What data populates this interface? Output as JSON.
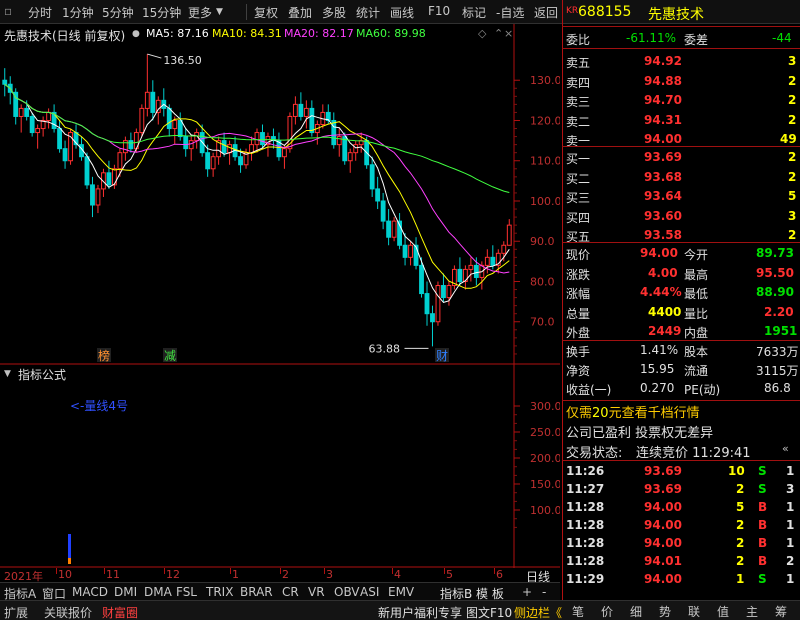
{
  "toolbar": {
    "items": [
      "分时",
      "1分钟",
      "5分钟",
      "15分钟",
      "更多",
      "复权",
      "叠加",
      "多股",
      "统计",
      "画线",
      "F10",
      "标记",
      "-自选",
      "返回"
    ]
  },
  "chart": {
    "title": "先惠技术(日线 前复权)",
    "ma": [
      {
        "label": "MA5: 87.16",
        "color": "#ffffff"
      },
      {
        "label": "MA10: 84.31",
        "color": "#ffff00"
      },
      {
        "label": "MA20: 82.17",
        "color": "#ff40ff"
      },
      {
        "label": "MA60: 89.98",
        "color": "#40ff40"
      }
    ],
    "high_label": "136.50",
    "low_label": "63.88",
    "price_ticks": [
      "130.0",
      "120.0",
      "110.0",
      "100.0",
      "90.0",
      "80.0",
      "70.0"
    ],
    "markers": [
      {
        "text": "榜"
      },
      {
        "text": "减"
      },
      {
        "text": "财"
      }
    ],
    "x_labels": [
      "2021年",
      "10",
      "11",
      "12",
      "1",
      "2",
      "3",
      "4",
      "5",
      "6"
    ],
    "period_label": "日线",
    "candles": [
      [
        130,
        133,
        126,
        129
      ],
      [
        129,
        131,
        124,
        127
      ],
      [
        127,
        128,
        119,
        121
      ],
      [
        121,
        124,
        117,
        123
      ],
      [
        123,
        125,
        120,
        121
      ],
      [
        121,
        122,
        116,
        117
      ],
      [
        117,
        119,
        113,
        118
      ],
      [
        118,
        121,
        116,
        120
      ],
      [
        120,
        123,
        118,
        122
      ],
      [
        122,
        124,
        117,
        118
      ],
      [
        118,
        120,
        112,
        113
      ],
      [
        113,
        115,
        108,
        110
      ],
      [
        110,
        118,
        109,
        117
      ],
      [
        117,
        119,
        113,
        114
      ],
      [
        114,
        116,
        110,
        111
      ],
      [
        111,
        112,
        103,
        104
      ],
      [
        104,
        106,
        96,
        99
      ],
      [
        99,
        104,
        97,
        103
      ],
      [
        103,
        108,
        101,
        107
      ],
      [
        107,
        110,
        103,
        104
      ],
      [
        104,
        109,
        103,
        108
      ],
      [
        108,
        113,
        106,
        112
      ],
      [
        112,
        116,
        110,
        115
      ],
      [
        115,
        117,
        112,
        113
      ],
      [
        113,
        118,
        112,
        117
      ],
      [
        117,
        124,
        116,
        123
      ],
      [
        123,
        136.5,
        121,
        127
      ],
      [
        127,
        130,
        120,
        122
      ],
      [
        122,
        126,
        119,
        125
      ],
      [
        125,
        128,
        121,
        123
      ],
      [
        123,
        124,
        116,
        118
      ],
      [
        118,
        121,
        114,
        120
      ],
      [
        120,
        122,
        115,
        116
      ],
      [
        116,
        118,
        111,
        113
      ],
      [
        113,
        116,
        110,
        115
      ],
      [
        115,
        118,
        113,
        117
      ],
      [
        117,
        119,
        111,
        112
      ],
      [
        112,
        114,
        106,
        108
      ],
      [
        108,
        112,
        106,
        111
      ],
      [
        111,
        116,
        109,
        115
      ],
      [
        115,
        117,
        111,
        112
      ],
      [
        112,
        115,
        109,
        114
      ],
      [
        114,
        116,
        110,
        111
      ],
      [
        111,
        113,
        107,
        109
      ],
      [
        109,
        113,
        108,
        112
      ],
      [
        112,
        116,
        110,
        114
      ],
      [
        114,
        118,
        112,
        117
      ],
      [
        117,
        119,
        113,
        114
      ],
      [
        114,
        117,
        111,
        116
      ],
      [
        116,
        118,
        113,
        115
      ],
      [
        115,
        117,
        110,
        111
      ],
      [
        111,
        114,
        108,
        113
      ],
      [
        113,
        122,
        112,
        121
      ],
      [
        121,
        126,
        119,
        124
      ],
      [
        124,
        127,
        120,
        121
      ],
      [
        121,
        125,
        118,
        123
      ],
      [
        123,
        125,
        116,
        117
      ],
      [
        117,
        120,
        114,
        119
      ],
      [
        119,
        124,
        118,
        122
      ],
      [
        122,
        124,
        119,
        120
      ],
      [
        120,
        122,
        113,
        114
      ],
      [
        114,
        118,
        111,
        116
      ],
      [
        116,
        117,
        109,
        110
      ],
      [
        110,
        113,
        107,
        112
      ],
      [
        112,
        115,
        110,
        114
      ],
      [
        114,
        117,
        112,
        115
      ],
      [
        115,
        116,
        108,
        109
      ],
      [
        109,
        111,
        101,
        103
      ],
      [
        103,
        106,
        98,
        100
      ],
      [
        100,
        102,
        93,
        95
      ],
      [
        95,
        98,
        89,
        91
      ],
      [
        91,
        96,
        90,
        95
      ],
      [
        95,
        97,
        88,
        89
      ],
      [
        89,
        92,
        84,
        86
      ],
      [
        86,
        90,
        84,
        89
      ],
      [
        89,
        91,
        83,
        84
      ],
      [
        84,
        86,
        76,
        77
      ],
      [
        77,
        80,
        69,
        72
      ],
      [
        72,
        74,
        63.88,
        70
      ],
      [
        70,
        80,
        69,
        79
      ],
      [
        79,
        82,
        75,
        76
      ],
      [
        76,
        80,
        74,
        79
      ],
      [
        79,
        84,
        78,
        83
      ],
      [
        83,
        86,
        79,
        80
      ],
      [
        80,
        84,
        78,
        83
      ],
      [
        83,
        86,
        80,
        84
      ],
      [
        84,
        86,
        79,
        81
      ],
      [
        81,
        85,
        78,
        84
      ],
      [
        84,
        88,
        82,
        86
      ],
      [
        86,
        89,
        83,
        84
      ],
      [
        84,
        88,
        82,
        87
      ],
      [
        87,
        90,
        85,
        89
      ],
      [
        89,
        95.5,
        88.9,
        94
      ]
    ]
  },
  "indicator": {
    "title": "指标公式",
    "label": "<-量线4号",
    "ticks": [
      "300.0",
      "250.0",
      "200.0",
      "150.0",
      "100.0"
    ]
  },
  "tabs": [
    "指标A",
    "窗口",
    "MACD",
    "DMI",
    "DMA",
    "FSL",
    "TRIX",
    "BRAR",
    "CR",
    "VR",
    "OBV",
    "ASI",
    "EMV",
    "指标B",
    "模 板",
    "+",
    "-"
  ],
  "status_bar": {
    "items": [
      "扩展",
      "关联报价",
      "财富圈"
    ],
    "promo": "新用户福利专享",
    "right_items": [
      "图文F10",
      "侧边栏《"
    ],
    "panel_tabs": [
      "笔",
      "价",
      "细",
      "势",
      "联",
      "值",
      "主",
      "筹"
    ]
  },
  "quote": {
    "code_prefix": "KR",
    "code": "688155",
    "name": "先惠技术",
    "wei_bi_label": "委比",
    "wei_bi": "-61.11%",
    "wei_cha_label": "委差",
    "wei_cha": "-44",
    "sell": [
      {
        "label": "卖五",
        "price": "94.92",
        "vol": "3"
      },
      {
        "label": "卖四",
        "price": "94.88",
        "vol": "2"
      },
      {
        "label": "卖三",
        "price": "94.70",
        "vol": "2"
      },
      {
        "label": "卖二",
        "price": "94.31",
        "vol": "2"
      },
      {
        "label": "卖一",
        "price": "94.00",
        "vol": "49"
      }
    ],
    "buy": [
      {
        "label": "买一",
        "price": "93.69",
        "vol": "2"
      },
      {
        "label": "买二",
        "price": "93.68",
        "vol": "2"
      },
      {
        "label": "买三",
        "price": "93.64",
        "vol": "5"
      },
      {
        "label": "买四",
        "price": "93.60",
        "vol": "3"
      },
      {
        "label": "买五",
        "price": "93.58",
        "vol": "2"
      }
    ],
    "stats": [
      {
        "l1": "现价",
        "v1": "94.00",
        "c1": "red",
        "l2": "今开",
        "v2": "89.73",
        "c2": "green"
      },
      {
        "l1": "涨跌",
        "v1": "4.00",
        "c1": "red",
        "l2": "最高",
        "v2": "95.50",
        "c2": "red"
      },
      {
        "l1": "涨幅",
        "v1": "4.44%",
        "c1": "red",
        "l2": "最低",
        "v2": "88.90",
        "c2": "green"
      },
      {
        "l1": "总量",
        "v1": "4400",
        "c1": "yel",
        "l2": "量比",
        "v2": "2.20",
        "c2": "red"
      },
      {
        "l1": "外盘",
        "v1": "2449",
        "c1": "red",
        "l2": "内盘",
        "v2": "1951",
        "c2": "green"
      }
    ],
    "stats2": [
      {
        "l1": "换手",
        "v1": "1.41%",
        "l2": "股本",
        "v2": "7633万"
      },
      {
        "l1": "净资",
        "v1": "15.95",
        "l2": "流通",
        "v2": "3115万"
      },
      {
        "l1": "收益(一)",
        "v1": "0.270",
        "l2": "PE(动)",
        "v2": "86.8"
      }
    ],
    "promo_prefix": "仅需",
    "promo_num": "20",
    "promo_suffix": "元查看千档行情",
    "notice": "公司已盈利 投票权无差异",
    "trade_status_label": "交易状态:",
    "trade_status": "连续竞价 11:29:41",
    "ticks": [
      {
        "time": "11:26",
        "price": "93.69",
        "pc": "red",
        "vol": "10",
        "side": "S",
        "sc": "green",
        "n": "1"
      },
      {
        "time": "11:27",
        "price": "93.69",
        "pc": "red",
        "vol": "2",
        "side": "S",
        "sc": "green",
        "n": "3"
      },
      {
        "time": "11:28",
        "price": "94.00",
        "pc": "red",
        "vol": "5",
        "side": "B",
        "sc": "red",
        "n": "1"
      },
      {
        "time": "11:28",
        "price": "94.00",
        "pc": "red",
        "vol": "2",
        "side": "B",
        "sc": "red",
        "n": "1"
      },
      {
        "time": "11:28",
        "price": "94.00",
        "pc": "red",
        "vol": "2",
        "side": "B",
        "sc": "red",
        "n": "1"
      },
      {
        "time": "11:28",
        "price": "94.01",
        "pc": "red",
        "vol": "2",
        "side": "B",
        "sc": "red",
        "n": "2"
      },
      {
        "time": "11:29",
        "price": "94.00",
        "pc": "red",
        "vol": "1",
        "side": "S",
        "sc": "green",
        "n": "1"
      }
    ]
  }
}
